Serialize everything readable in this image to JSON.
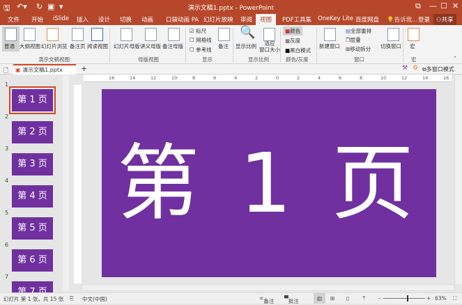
{
  "window": {
    "title": "演示文稿1.pptx - PowerPoint",
    "minimize": "—",
    "restore": "☐",
    "close": "✕",
    "ribbon_display": "⧉"
  },
  "quick_access": [
    "save-icon",
    "undo-icon",
    "redo-icon",
    "start-from-beginning-icon",
    "customize-icon"
  ],
  "tabs": [
    "文件",
    "开始",
    "iSlide",
    "插入",
    "设计",
    "切换",
    "动画",
    "口袋动画 PA",
    "幻灯片放映",
    "审阅",
    "视图",
    "PDF工具集",
    "OneKey Lite",
    "百度网盘"
  ],
  "active_tab": "视图",
  "tell_me": "告诉我...",
  "login": "登录",
  "share": "共享",
  "ribbon": {
    "presentation_views": {
      "label": "演示文稿视图",
      "items": [
        "普通",
        "大纲视图",
        "幻灯片浏览",
        "备注页",
        "阅读视图"
      ]
    },
    "master_views": {
      "label": "母版视图",
      "items": [
        "幻灯片母版",
        "讲义母版",
        "备注母版"
      ]
    },
    "show": {
      "label": "显示",
      "checkboxes": [
        {
          "label": "标尺",
          "checked": true
        },
        {
          "label": "网格线",
          "checked": false
        },
        {
          "label": "参考线",
          "checked": false
        }
      ],
      "notes": "备注"
    },
    "zoom": {
      "label": "显示比例",
      "items": [
        "显示比例",
        "适应\n窗口大小"
      ]
    },
    "color": {
      "label": "颜色/灰度",
      "items": [
        "颜色",
        "灰度",
        "黑白模式"
      ],
      "selected": "颜色"
    },
    "window": {
      "label": "窗口",
      "new_window": "新建窗口",
      "arrange_all": "全部重排",
      "cascade": "层叠",
      "move_split": "移动拆分",
      "switch_windows": "切换窗口"
    },
    "macros": {
      "label": "宏",
      "item": "宏"
    }
  },
  "doc_tab": {
    "name": "演示文稿1.pptx",
    "multi_window": "多窗口模式"
  },
  "ruler_labels": [
    "16",
    "14",
    "12",
    "10",
    "8",
    "6",
    "4",
    "2",
    "0",
    "2",
    "4",
    "6",
    "8",
    "10",
    "12",
    "14",
    "16"
  ],
  "slides": [
    {
      "n": "1",
      "text": "第 1 页"
    },
    {
      "n": "2",
      "text": "第 2 页"
    },
    {
      "n": "3",
      "text": "第 3 页"
    },
    {
      "n": "4",
      "text": "第 4 页"
    },
    {
      "n": "5",
      "text": "第 5 页"
    },
    {
      "n": "6",
      "text": "第 6 页"
    },
    {
      "n": "7",
      "text": "第 7 页"
    }
  ],
  "current_slide": {
    "text": "第 1 页",
    "background": "#7030A0"
  },
  "status": {
    "slide_info": "幻灯片 第 1 张，共 15 张",
    "language": "中文(中国)",
    "notes": "备注",
    "comments": "批注",
    "zoom": "63%",
    "zoom_level": 63
  }
}
